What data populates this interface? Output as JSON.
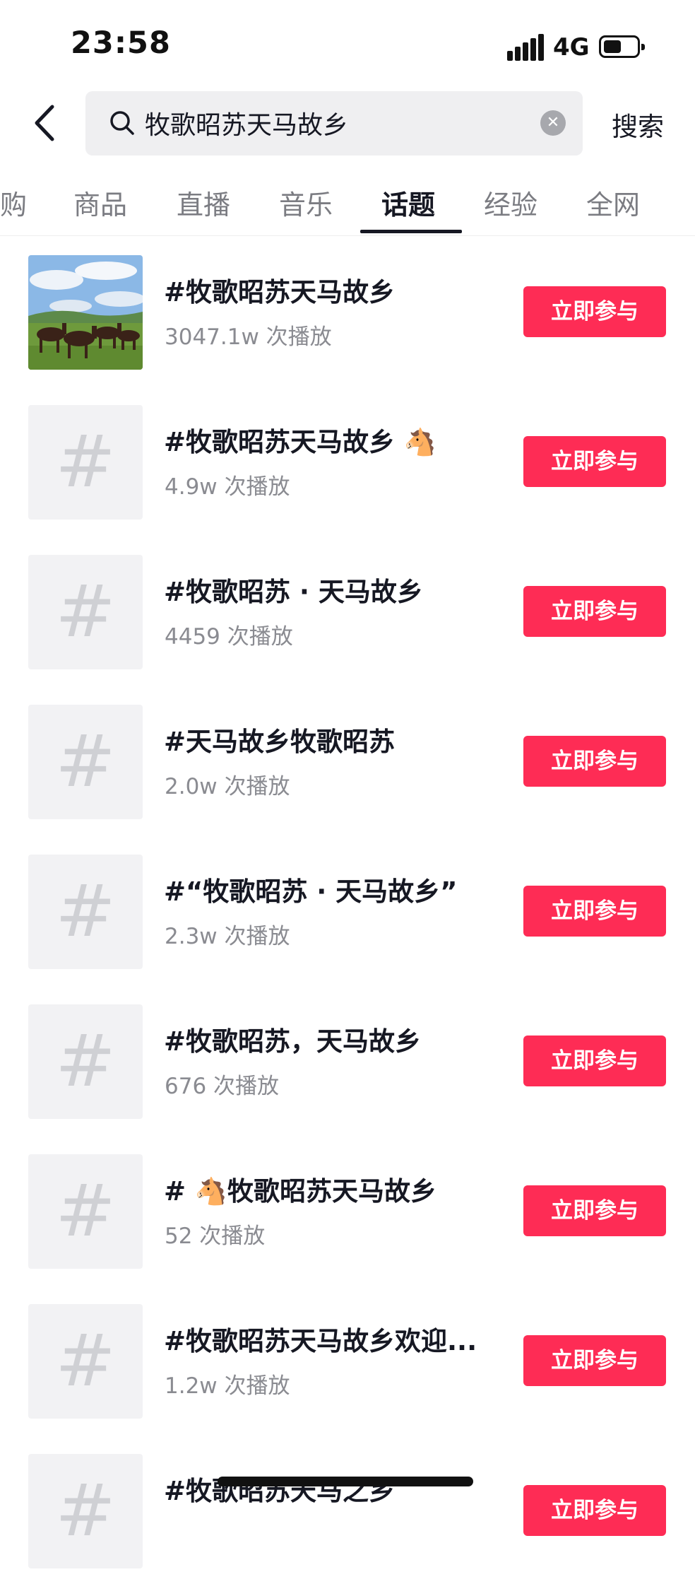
{
  "status_bar": {
    "time": "23:58",
    "network": "4G",
    "battery_level": 0.55
  },
  "search": {
    "query": "牧歌昭苏天马故乡",
    "submit_label": "搜索"
  },
  "tabs": [
    {
      "label": "购",
      "active": false
    },
    {
      "label": "商品",
      "active": false
    },
    {
      "label": "直播",
      "active": false
    },
    {
      "label": "音乐",
      "active": false
    },
    {
      "label": "话题",
      "active": true
    },
    {
      "label": "经验",
      "active": false
    },
    {
      "label": "全网",
      "active": false
    }
  ],
  "topics": [
    {
      "title": "#牧歌昭苏天马故乡",
      "views": "3047.1w 次播放",
      "button": "立即参与",
      "thumbnail": "horses-on-grassland-photo"
    },
    {
      "title": "#牧歌昭苏天马故乡 🐴",
      "views": "4.9w 次播放",
      "button": "立即参与",
      "thumbnail": "hash-icon"
    },
    {
      "title": "#牧歌昭苏 · 天马故乡",
      "views": "4459 次播放",
      "button": "立即参与",
      "thumbnail": "hash-icon"
    },
    {
      "title": "#天马故乡牧歌昭苏",
      "views": "2.0w 次播放",
      "button": "立即参与",
      "thumbnail": "hash-icon"
    },
    {
      "title": "#“牧歌昭苏 · 天马故乡”",
      "views": "2.3w 次播放",
      "button": "立即参与",
      "thumbnail": "hash-icon"
    },
    {
      "title": "#牧歌昭苏，天马故乡",
      "views": "676 次播放",
      "button": "立即参与",
      "thumbnail": "hash-icon"
    },
    {
      "title": "# 🐴牧歌昭苏天马故乡",
      "views": "52 次播放",
      "button": "立即参与",
      "thumbnail": "hash-icon"
    },
    {
      "title": "#牧歌昭苏天马故乡欢迎...",
      "views": "1.2w 次播放",
      "button": "立即参与",
      "thumbnail": "hash-icon"
    },
    {
      "title": "#牧歌昭苏天马之乡",
      "views": "",
      "button": "立即参与",
      "thumbnail": "hash-icon"
    }
  ],
  "hash_symbol": "#",
  "colors": {
    "accent": "#fe2c55",
    "text_primary": "#161823",
    "text_secondary": "#8a8b91",
    "thumb_bg": "#f2f2f4"
  }
}
